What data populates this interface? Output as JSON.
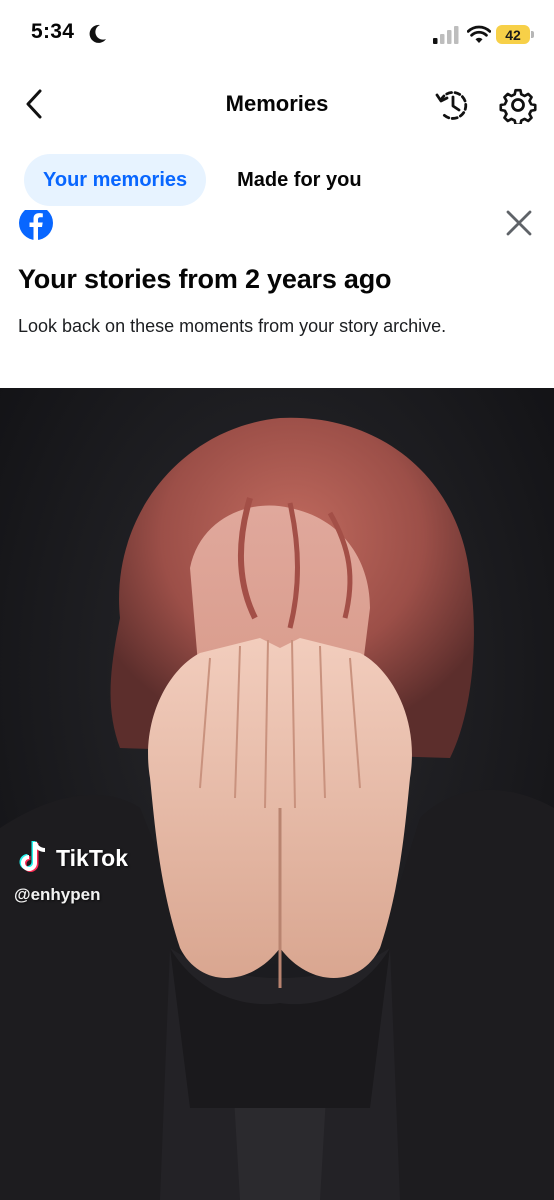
{
  "status_bar": {
    "time": "5:34",
    "battery": "42",
    "icons": [
      "moon-icon",
      "signal-icon",
      "wifi-icon",
      "battery-icon"
    ]
  },
  "header": {
    "title": "Memories",
    "icons": [
      "back-arrow-icon",
      "history-icon",
      "gear-icon"
    ]
  },
  "tabs": [
    {
      "label": "Your memories",
      "active": true
    },
    {
      "label": "Made for you",
      "active": false
    }
  ],
  "card": {
    "title": "Your stories from 2 years ago",
    "description": "Look back on these moments from your story archive.",
    "icons": [
      "facebook-logo-icon",
      "close-icon"
    ]
  },
  "story": {
    "watermark_brand": "TikTok",
    "watermark_handle": "@enhypen"
  },
  "colors": {
    "accent": "#0866ff",
    "tab_active_bg": "#e7f3ff",
    "battery": "#f7d048"
  }
}
